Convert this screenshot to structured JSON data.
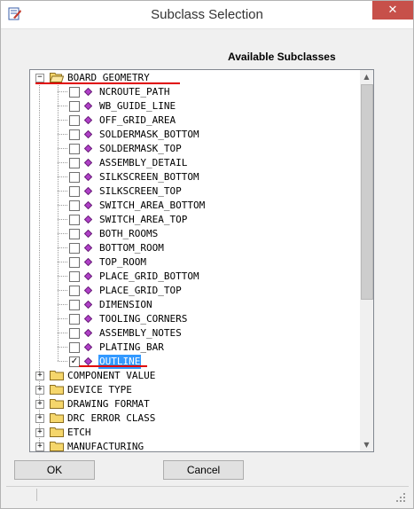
{
  "window": {
    "title": "Subclass Selection",
    "close_glyph": "✕",
    "app_icon": "application-icon"
  },
  "panel": {
    "heading": "Available Subclasses"
  },
  "tree": {
    "expanded": {
      "label": "BOARD GEOMETRY",
      "expander": "−",
      "subclasses": [
        {
          "label": "NCROUTE_PATH",
          "checked": false
        },
        {
          "label": "WB_GUIDE_LINE",
          "checked": false
        },
        {
          "label": "OFF_GRID_AREA",
          "checked": false
        },
        {
          "label": "SOLDERMASK_BOTTOM",
          "checked": false
        },
        {
          "label": "SOLDERMASK_TOP",
          "checked": false
        },
        {
          "label": "ASSEMBLY_DETAIL",
          "checked": false
        },
        {
          "label": "SILKSCREEN_BOTTOM",
          "checked": false
        },
        {
          "label": "SILKSCREEN_TOP",
          "checked": false
        },
        {
          "label": "SWITCH_AREA_BOTTOM",
          "checked": false
        },
        {
          "label": "SWITCH_AREA_TOP",
          "checked": false
        },
        {
          "label": "BOTH_ROOMS",
          "checked": false
        },
        {
          "label": "BOTTOM_ROOM",
          "checked": false
        },
        {
          "label": "TOP_ROOM",
          "checked": false
        },
        {
          "label": "PLACE_GRID_BOTTOM",
          "checked": false
        },
        {
          "label": "PLACE_GRID_TOP",
          "checked": false
        },
        {
          "label": "DIMENSION",
          "checked": false
        },
        {
          "label": "TOOLING_CORNERS",
          "checked": false
        },
        {
          "label": "ASSEMBLY_NOTES",
          "checked": false
        },
        {
          "label": "PLATING_BAR",
          "checked": false
        },
        {
          "label": "OUTLINE",
          "checked": true,
          "selected": true
        }
      ]
    },
    "collapsed": [
      {
        "label": "COMPONENT VALUE",
        "expander": "+"
      },
      {
        "label": "DEVICE TYPE",
        "expander": "+"
      },
      {
        "label": "DRAWING FORMAT",
        "expander": "+"
      },
      {
        "label": "DRC ERROR CLASS",
        "expander": "+"
      },
      {
        "label": "ETCH",
        "expander": "+"
      },
      {
        "label": "MANUFACTURING",
        "expander": "+"
      }
    ],
    "check_glyph": "✓"
  },
  "scrollbar": {
    "up_glyph": "▲",
    "down_glyph": "▼"
  },
  "buttons": {
    "ok": "OK",
    "cancel": "Cancel"
  },
  "colors": {
    "selection": "#3399ff",
    "annotation_underline": "#e00000",
    "folder": "#f5d66b",
    "gem": "#b040c8",
    "close": "#c7504a"
  }
}
